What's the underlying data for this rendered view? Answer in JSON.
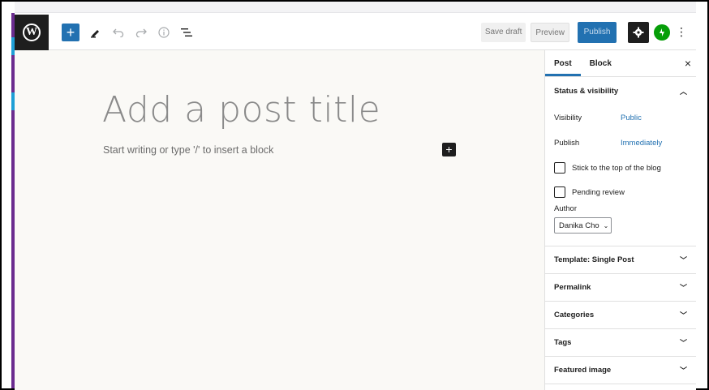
{
  "header": {
    "logo": "wordpress-logo",
    "save_draft": "Save draft",
    "preview": "Preview",
    "publish": "Publish"
  },
  "editor": {
    "title_placeholder": "Add a post title",
    "paragraph_placeholder": "Start writing or type '/' to insert a block"
  },
  "sidebar": {
    "tabs": [
      "Post",
      "Block"
    ],
    "status_panel": {
      "title": "Status & visibility",
      "visibility_label": "Visibility",
      "visibility_value": "Public",
      "publish_label": "Publish",
      "publish_value": "Immediately",
      "stick_label": "Stick to the top of the blog",
      "pending_label": "Pending review",
      "author_label": "Author",
      "author_value": "Danika Cho"
    },
    "panels": [
      "Template: Single Post",
      "Permalink",
      "Categories",
      "Tags",
      "Featured image"
    ]
  },
  "colors": {
    "accent": "#2271b1",
    "dark": "#1e1e1e",
    "jetpack": "#069e08",
    "canvas": "#faf9f6"
  }
}
